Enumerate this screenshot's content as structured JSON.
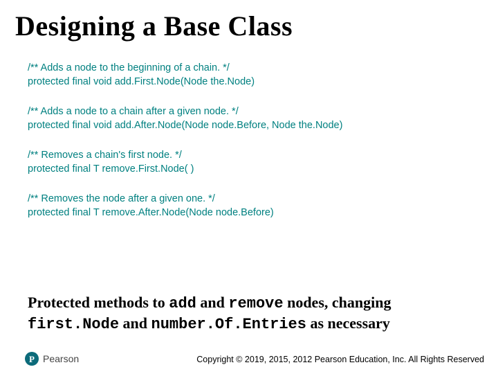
{
  "title": "Designing a Base Class",
  "blocks": [
    {
      "comment": "/** Adds a node to the beginning of a chain. */",
      "decl": "protected final void add.First.Node(Node the.Node)"
    },
    {
      "comment": "/** Adds a node to a chain after a given node. */",
      "decl": "protected final void add.After.Node(Node node.Before, Node the.Node)"
    },
    {
      "comment": "/** Removes a chain's first node. */",
      "decl": "protected final T remove.First.Node( )"
    },
    {
      "comment": "/** Removes the node after a given one. */",
      "decl": "protected final T remove.After.Node(Node node.Before)"
    }
  ],
  "caption": {
    "pre": "Protected methods to ",
    "m1": "add",
    "mid1": " and ",
    "m2": "remove",
    "mid2": " nodes, changing ",
    "m3": "first.Node",
    "mid3": " and ",
    "m4": "number.Of.Entries",
    "post": " as necessary"
  },
  "footer": {
    "brand": "Pearson",
    "brand_p": "P",
    "copyright": "Copyright © 2019, 2015, 2012 Pearson Education, Inc. All Rights Reserved"
  }
}
